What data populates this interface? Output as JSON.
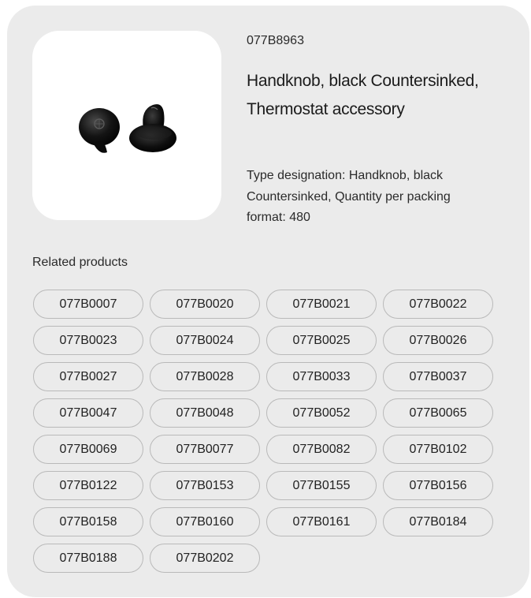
{
  "product": {
    "code": "077B8963",
    "title": "Handknob, black Countersinked, Thermostat accessory",
    "description": "Type designation: Handknob, black Countersinked, Quantity per packing format: 480"
  },
  "related": {
    "heading": "Related products",
    "items": [
      "077B0007",
      "077B0020",
      "077B0021",
      "077B0022",
      "077B0023",
      "077B0024",
      "077B0025",
      "077B0026",
      "077B0027",
      "077B0028",
      "077B0033",
      "077B0037",
      "077B0047",
      "077B0048",
      "077B0052",
      "077B0065",
      "077B0069",
      "077B0077",
      "077B0082",
      "077B0102",
      "077B0122",
      "077B0153",
      "077B0155",
      "077B0156",
      "077B0158",
      "077B0160",
      "077B0161",
      "077B0184",
      "077B0188",
      "077B0202"
    ]
  },
  "colors": {
    "card_background": "#ebebeb",
    "image_background": "#ffffff",
    "pill_border": "#b9b9b9",
    "text": "#1b1b1b"
  }
}
